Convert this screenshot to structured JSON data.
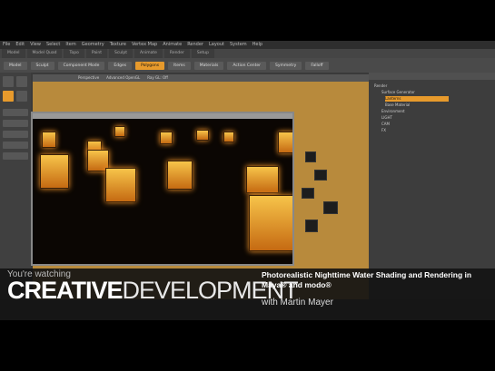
{
  "menubar": {
    "items": [
      "File",
      "Edit",
      "View",
      "Select",
      "Item",
      "Geometry",
      "Texture",
      "Vertex Map",
      "Animate",
      "Render",
      "Layout",
      "System",
      "Help"
    ]
  },
  "modebar": {
    "tabs": [
      "Model",
      "Model Quad",
      "Topo",
      "Paint",
      "Sculpt",
      "Animate",
      "Render",
      "Setup"
    ]
  },
  "toolbar": {
    "buttons": [
      "Model",
      "Sculpt",
      "Component Mode",
      "Edges",
      "Polygons",
      "Items",
      "Materials",
      "Action Center",
      "Symmetry",
      "Falloff"
    ]
  },
  "viewport": {
    "tabs": [
      "Perspective",
      "Advanced OpenGL",
      "Ray GL: Off"
    ]
  },
  "rightpanel": {
    "rows": [
      "Render",
      "Surface Generator",
      "Lanterns",
      "Base Material",
      "Environment",
      "LIGHT",
      "CAM",
      "FX"
    ]
  },
  "overlay": {
    "watching": "You're watching",
    "brand_part1": "CREATIVE",
    "brand_part2": "DEVELOPMENT",
    "course_title": "Photorealistic Nighttime Water Shading and Rendering in Maya® and modo®",
    "author": "with Martin Mayer"
  },
  "colors": {
    "accent": "#e79a2c",
    "lantern_glow": "#f7c44a",
    "ui_bg": "#3a3a3a"
  }
}
